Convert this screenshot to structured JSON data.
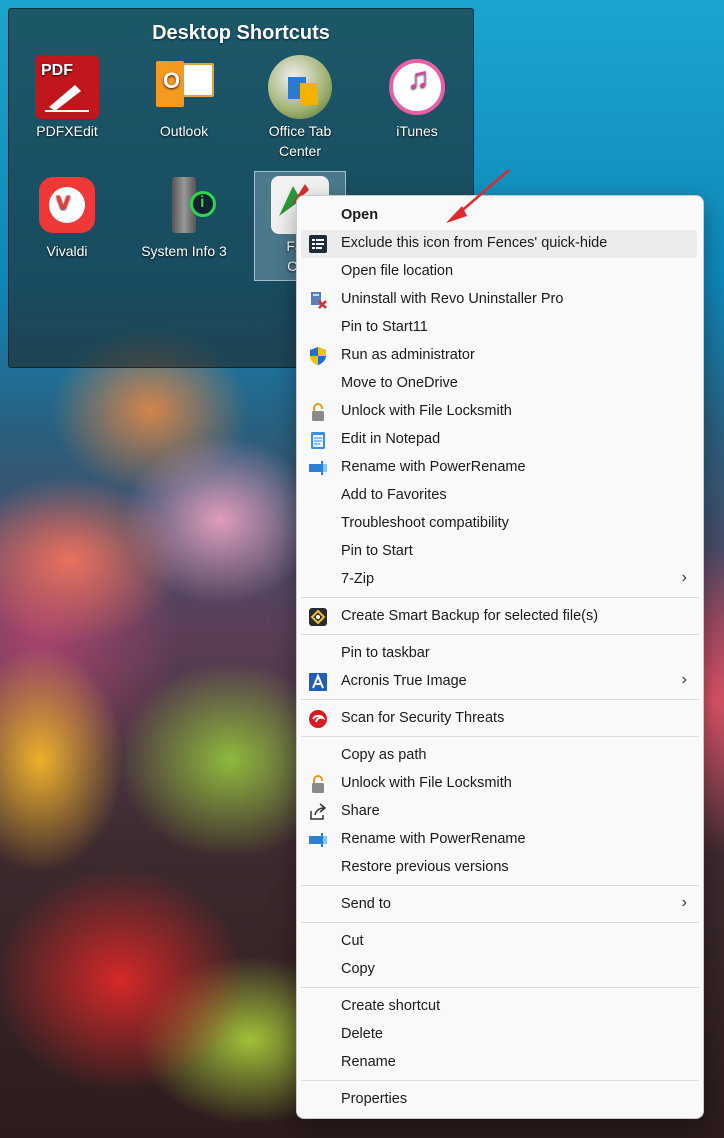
{
  "fence": {
    "title": "Desktop Shortcuts",
    "icons": [
      {
        "label": "PDFXEdit",
        "label2": ""
      },
      {
        "label": "Outlook",
        "label2": ""
      },
      {
        "label": "Office Tab",
        "label2": "Center"
      },
      {
        "label": "iTunes",
        "label2": ""
      },
      {
        "label": "Vivaldi",
        "label2": ""
      },
      {
        "label": "System Info 3",
        "label2": ""
      },
      {
        "label": "Fast",
        "label2": "Cap"
      }
    ]
  },
  "icon_text": {
    "pdf": "PDF",
    "outlook": "O",
    "info": "i"
  },
  "menu": {
    "items": [
      {
        "label": "Open",
        "icon": "none"
      },
      {
        "label": "Exclude this icon from Fences' quick-hide",
        "icon": "fences-icon"
      },
      {
        "label": "Open file location",
        "icon": "none"
      },
      {
        "label": "Uninstall with Revo Uninstaller Pro",
        "icon": "revo-icon"
      },
      {
        "label": "Pin to Start11",
        "icon": "none"
      },
      {
        "label": "Run as administrator",
        "icon": "uac-shield-icon"
      },
      {
        "label": "Move to OneDrive",
        "icon": "none"
      },
      {
        "label": "Unlock with File Locksmith",
        "icon": "lock-icon"
      },
      {
        "label": "Edit in Notepad",
        "icon": "notepad-icon"
      },
      {
        "label": "Rename with PowerRename",
        "icon": "powerrename-icon"
      },
      {
        "label": "Add to Favorites",
        "icon": "none"
      },
      {
        "label": "Troubleshoot compatibility",
        "icon": "none"
      },
      {
        "label": "Pin to Start",
        "icon": "none"
      },
      {
        "label": "7-Zip",
        "icon": "none",
        "submenu": "›"
      },
      {
        "label": "Create Smart Backup for selected file(s)",
        "icon": "backup-icon"
      },
      {
        "label": "Pin to taskbar",
        "icon": "none"
      },
      {
        "label": "Acronis True Image",
        "icon": "acronis-icon",
        "submenu": "›"
      },
      {
        "label": "Scan for Security Threats",
        "icon": "trendmicro-icon"
      },
      {
        "label": "Copy as path",
        "icon": "none"
      },
      {
        "label": "Unlock with File Locksmith",
        "icon": "lock-icon"
      },
      {
        "label": "Share",
        "icon": "share-icon"
      },
      {
        "label": "Rename with PowerRename",
        "icon": "powerrename-icon"
      },
      {
        "label": "Restore previous versions",
        "icon": "none"
      },
      {
        "label": "Send to",
        "icon": "none",
        "submenu": "›"
      },
      {
        "label": "Cut",
        "icon": "none"
      },
      {
        "label": "Copy",
        "icon": "none"
      },
      {
        "label": "Create shortcut",
        "icon": "none"
      },
      {
        "label": "Delete",
        "icon": "none"
      },
      {
        "label": "Rename",
        "icon": "none"
      },
      {
        "label": "Properties",
        "icon": "none"
      }
    ]
  },
  "colors": {
    "annotation_arrow": "#e0282d",
    "menu_bg": "#f9f9f9",
    "hover_bg": "#ececec"
  }
}
